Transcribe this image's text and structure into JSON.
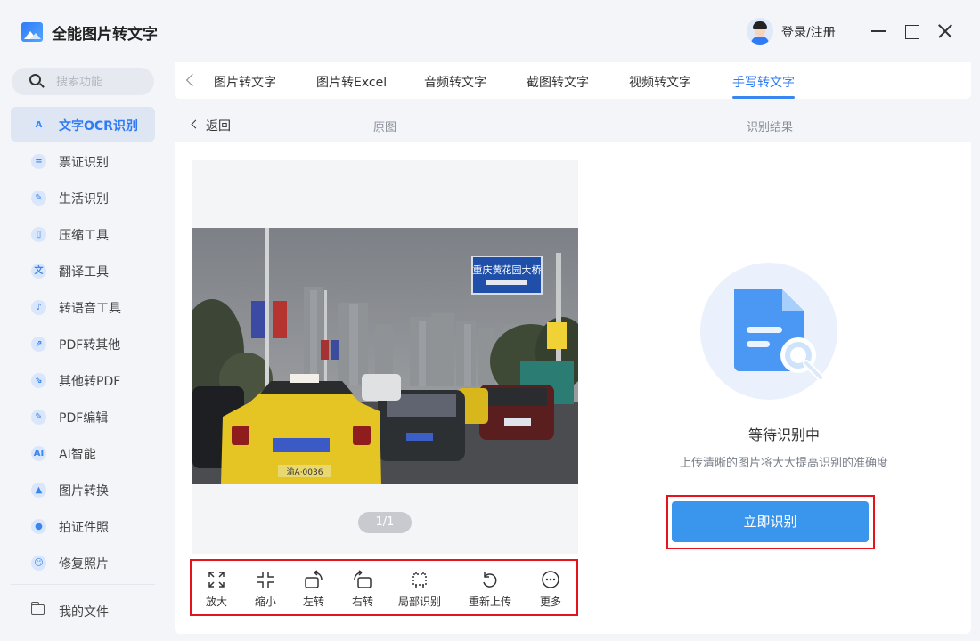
{
  "app": {
    "title": "全能图片转文字",
    "login_label": "登录/注册"
  },
  "search": {
    "placeholder": "搜索功能"
  },
  "sidebar": {
    "items": [
      {
        "label": "文字OCR识别",
        "icon": "A"
      },
      {
        "label": "票证识别",
        "icon": "="
      },
      {
        "label": "生活识别",
        "icon": "✎"
      },
      {
        "label": "压缩工具",
        "icon": "▯"
      },
      {
        "label": "翻译工具",
        "icon": "文"
      },
      {
        "label": "转语音工具",
        "icon": "♪"
      },
      {
        "label": "PDF转其他",
        "icon": "⇗"
      },
      {
        "label": "其他转PDF",
        "icon": "⇘"
      },
      {
        "label": "PDF编辑",
        "icon": "✎"
      },
      {
        "label": "AI智能",
        "icon": "AI"
      },
      {
        "label": "图片转换",
        "icon": "▲"
      },
      {
        "label": "拍证件照",
        "icon": "●"
      },
      {
        "label": "修复照片",
        "icon": "☺"
      }
    ],
    "files_label": "我的文件"
  },
  "tabs": [
    "图片转文字",
    "图片转Excel",
    "音频转文字",
    "截图转文字",
    "视频转文字",
    "手写转文字"
  ],
  "subheader": {
    "back": "返回",
    "original": "原图",
    "result": "识别结果"
  },
  "image": {
    "page_indicator": "1/1",
    "sign_text": "重庆黄花园大桥",
    "plate_front": "渝A·0036"
  },
  "toolbar": {
    "tools": [
      {
        "label": "放大",
        "icon": "zoom-in-icon"
      },
      {
        "label": "缩小",
        "icon": "zoom-out-icon"
      },
      {
        "label": "左转",
        "icon": "rotate-left-icon"
      },
      {
        "label": "右转",
        "icon": "rotate-right-icon"
      },
      {
        "label": "局部识别",
        "icon": "crop-icon"
      },
      {
        "label": "重新上传",
        "icon": "reupload-icon"
      },
      {
        "label": "更多",
        "icon": "more-icon"
      }
    ]
  },
  "result": {
    "title": "等待识别中",
    "hint": "上传清晰的图片将大大提高识别的准确度",
    "button": "立即识别"
  },
  "colors": {
    "accent": "#2f7bf5",
    "button": "#3a96ec",
    "highlight": "#e3141c"
  }
}
